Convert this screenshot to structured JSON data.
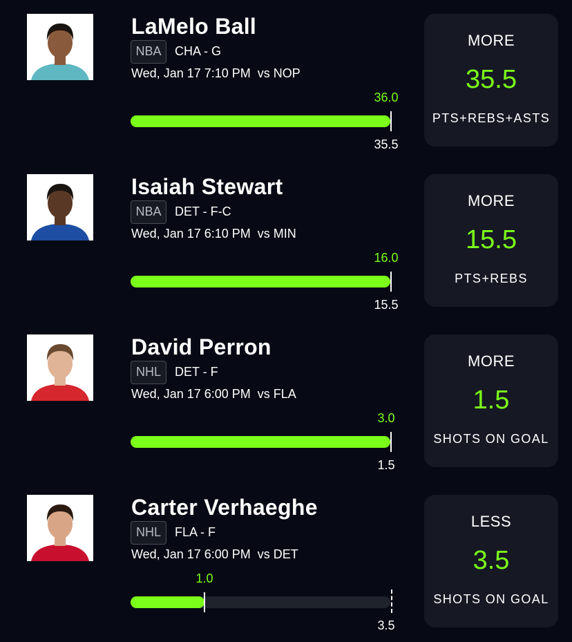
{
  "picks": [
    {
      "player": "LaMelo Ball",
      "league": "NBA",
      "team_position": "CHA - G",
      "game_time": "Wed, Jan 17 7:10 PM",
      "opponent": "vs NOP",
      "actual": "36.0",
      "line": "35.5",
      "progress": 1.0,
      "direction": "MORE",
      "stat": "PTS+REBS+ASTS",
      "avatar_icon": "player-headshot-icon",
      "jersey_color": "#5fb7c1"
    },
    {
      "player": "Isaiah Stewart",
      "league": "NBA",
      "team_position": "DET - F-C",
      "game_time": "Wed, Jan 17 6:10 PM",
      "opponent": "vs MIN",
      "actual": "16.0",
      "line": "15.5",
      "progress": 1.0,
      "direction": "MORE",
      "stat": "PTS+REBS",
      "avatar_icon": "player-headshot-icon",
      "jersey_color": "#1d4ea3"
    },
    {
      "player": "David Perron",
      "league": "NHL",
      "team_position": "DET - F",
      "game_time": "Wed, Jan 17 6:00 PM",
      "opponent": "vs FLA",
      "actual": "3.0",
      "line": "1.5",
      "progress": 1.0,
      "direction": "MORE",
      "stat": "SHOTS ON GOAL",
      "avatar_icon": "player-headshot-icon",
      "jersey_color": "#d6262e"
    },
    {
      "player": "Carter Verhaeghe",
      "league": "NHL",
      "team_position": "FLA - F",
      "game_time": "Wed, Jan 17 6:00 PM",
      "opponent": "vs DET",
      "actual": "1.0",
      "line": "3.5",
      "progress": 0.2857,
      "direction": "LESS",
      "stat": "SHOTS ON GOAL",
      "avatar_icon": "player-headshot-icon",
      "jersey_color": "#c8102e"
    }
  ],
  "colors": {
    "background": "#070a14",
    "card": "#161923",
    "accent_green": "#7bff1a",
    "track": "#1f232c"
  }
}
